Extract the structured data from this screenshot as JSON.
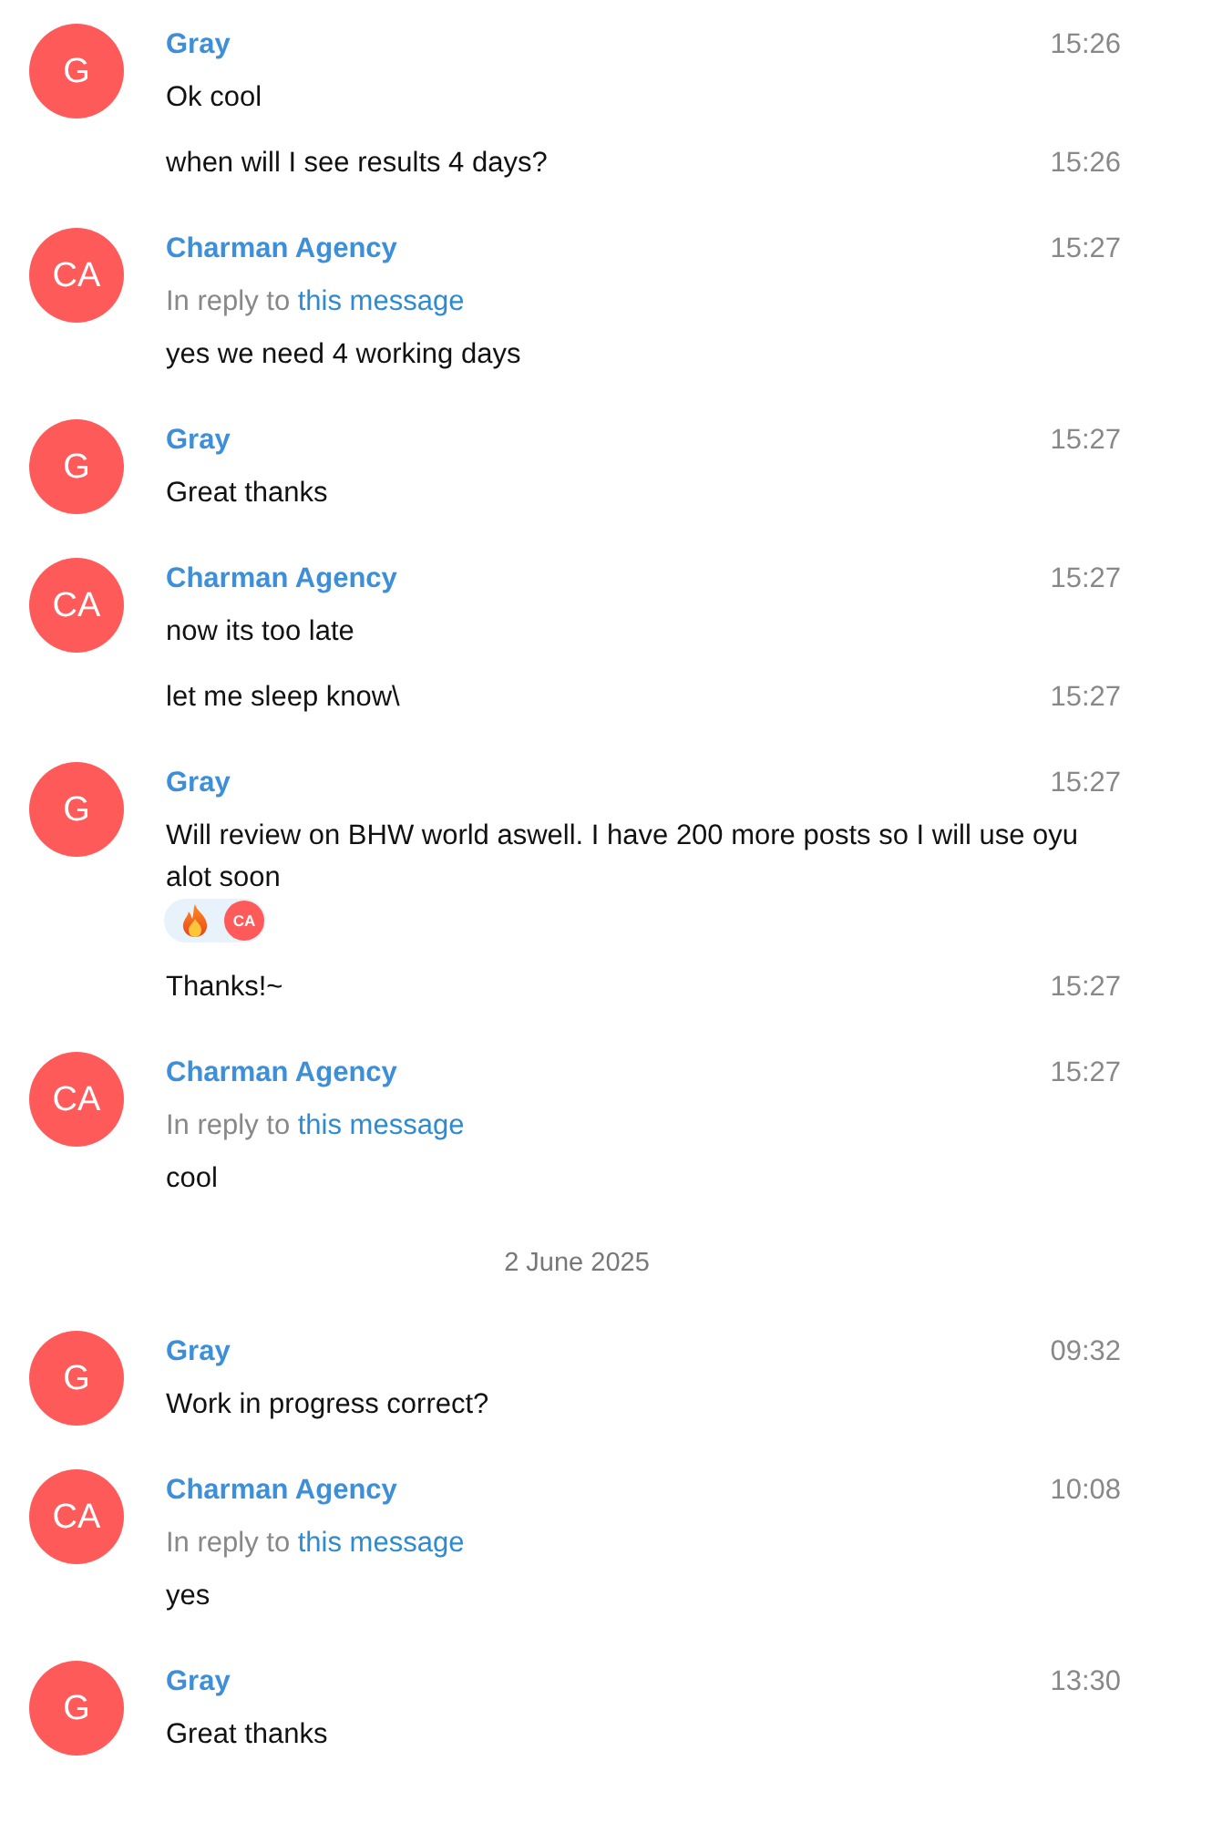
{
  "messages": [
    {
      "kind": "group",
      "sender": "Gray",
      "initials": "G",
      "time": "15:26",
      "entries": [
        {
          "text": "Ok cool"
        },
        {
          "text": "when will I see results 4 days?",
          "time": "15:26"
        }
      ]
    },
    {
      "kind": "group",
      "sender": "Charman Agency",
      "initials": "CA",
      "time": "15:27",
      "entries": [
        {
          "reply": {
            "label": "In reply to",
            "link": "this message"
          },
          "text": "yes we need 4 working days"
        }
      ]
    },
    {
      "kind": "group",
      "sender": "Gray",
      "initials": "G",
      "time": "15:27",
      "entries": [
        {
          "text": "Great thanks"
        }
      ]
    },
    {
      "kind": "group",
      "sender": "Charman Agency",
      "initials": "CA",
      "time": "15:27",
      "entries": [
        {
          "text": "now its too late"
        },
        {
          "text": "let me sleep know\\",
          "time": "15:27"
        }
      ]
    },
    {
      "kind": "group",
      "sender": "Gray",
      "initials": "G",
      "time": "15:27",
      "entries": [
        {
          "text": "Will review on BHW world aswell. I have 200 more posts so I will use oyu alot soon",
          "reactions": [
            {
              "initials": "CA"
            }
          ]
        },
        {
          "text": "Thanks!~",
          "time": "15:27"
        }
      ]
    },
    {
      "kind": "group",
      "sender": "Charman Agency",
      "initials": "CA",
      "time": "15:27",
      "entries": [
        {
          "reply": {
            "label": "In reply to",
            "link": "this message"
          },
          "text": "cool"
        }
      ]
    },
    {
      "kind": "date",
      "text": "2 June 2025"
    },
    {
      "kind": "group",
      "sender": "Gray",
      "initials": "G",
      "time": "09:32",
      "entries": [
        {
          "text": "Work in progress correct?"
        }
      ]
    },
    {
      "kind": "group",
      "sender": "Charman Agency",
      "initials": "CA",
      "time": "10:08",
      "entries": [
        {
          "reply": {
            "label": "In reply to",
            "link": "this message"
          },
          "text": "yes"
        }
      ]
    },
    {
      "kind": "group",
      "sender": "Gray",
      "initials": "G",
      "time": "13:30",
      "entries": [
        {
          "text": "Great thanks"
        }
      ]
    }
  ]
}
